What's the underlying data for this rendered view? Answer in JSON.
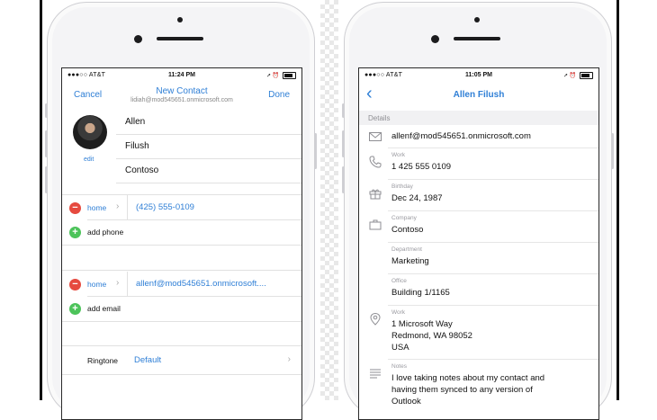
{
  "left_phone": {
    "status": {
      "carrier": "●●●○○ AT&T",
      "time": "11:24 PM"
    },
    "nav": {
      "cancel": "Cancel",
      "title": "New Contact",
      "subtitle": "lidiah@mod545651.onmicrosoft.com",
      "done": "Done"
    },
    "avatar_edit": "edit",
    "fields": {
      "first_name": "Allen",
      "last_name": "Filush",
      "company": "Contoso"
    },
    "phone": {
      "kind": "home",
      "value": "(425) 555-0109",
      "add_label": "add phone"
    },
    "email": {
      "kind": "home",
      "value": "allenf@mod545651.onmicrosoft....",
      "add_label": "add email"
    },
    "ringtone": {
      "label": "Ringtone",
      "value": "Default"
    }
  },
  "right_phone": {
    "status": {
      "carrier": "●●●○○ AT&T",
      "time": "11:05 PM"
    },
    "nav": {
      "title": "Allen Filush"
    },
    "section": "Details",
    "email": {
      "value": "allenf@mod545651.onmicrosoft.com",
      "icon": "envelope-icon"
    },
    "work_phone": {
      "label": "Work",
      "value": "1 425 555 0109",
      "icon": "phone-icon"
    },
    "birthday": {
      "label": "Birthday",
      "value": "Dec 24, 1987",
      "icon": "gift-icon"
    },
    "company": {
      "label": "Company",
      "value": "Contoso",
      "icon": "briefcase-icon"
    },
    "department": {
      "label": "Department",
      "value": "Marketing"
    },
    "office": {
      "label": "Office",
      "value": "Building 1/1165"
    },
    "work_address": {
      "label": "Work",
      "line1": "1 Microsoft Way",
      "line2": "Redmond, WA 98052",
      "line3": "USA",
      "icon": "location-pin-icon"
    },
    "notes": {
      "label": "Notes",
      "line1": "I love taking notes about my contact and",
      "line2": "having them synced to any version of",
      "line3": "Outlook",
      "icon": "notes-icon"
    }
  },
  "colors": {
    "accent": "#2f7fd6",
    "delete": "#e64a3f",
    "add": "#4cc35a"
  }
}
